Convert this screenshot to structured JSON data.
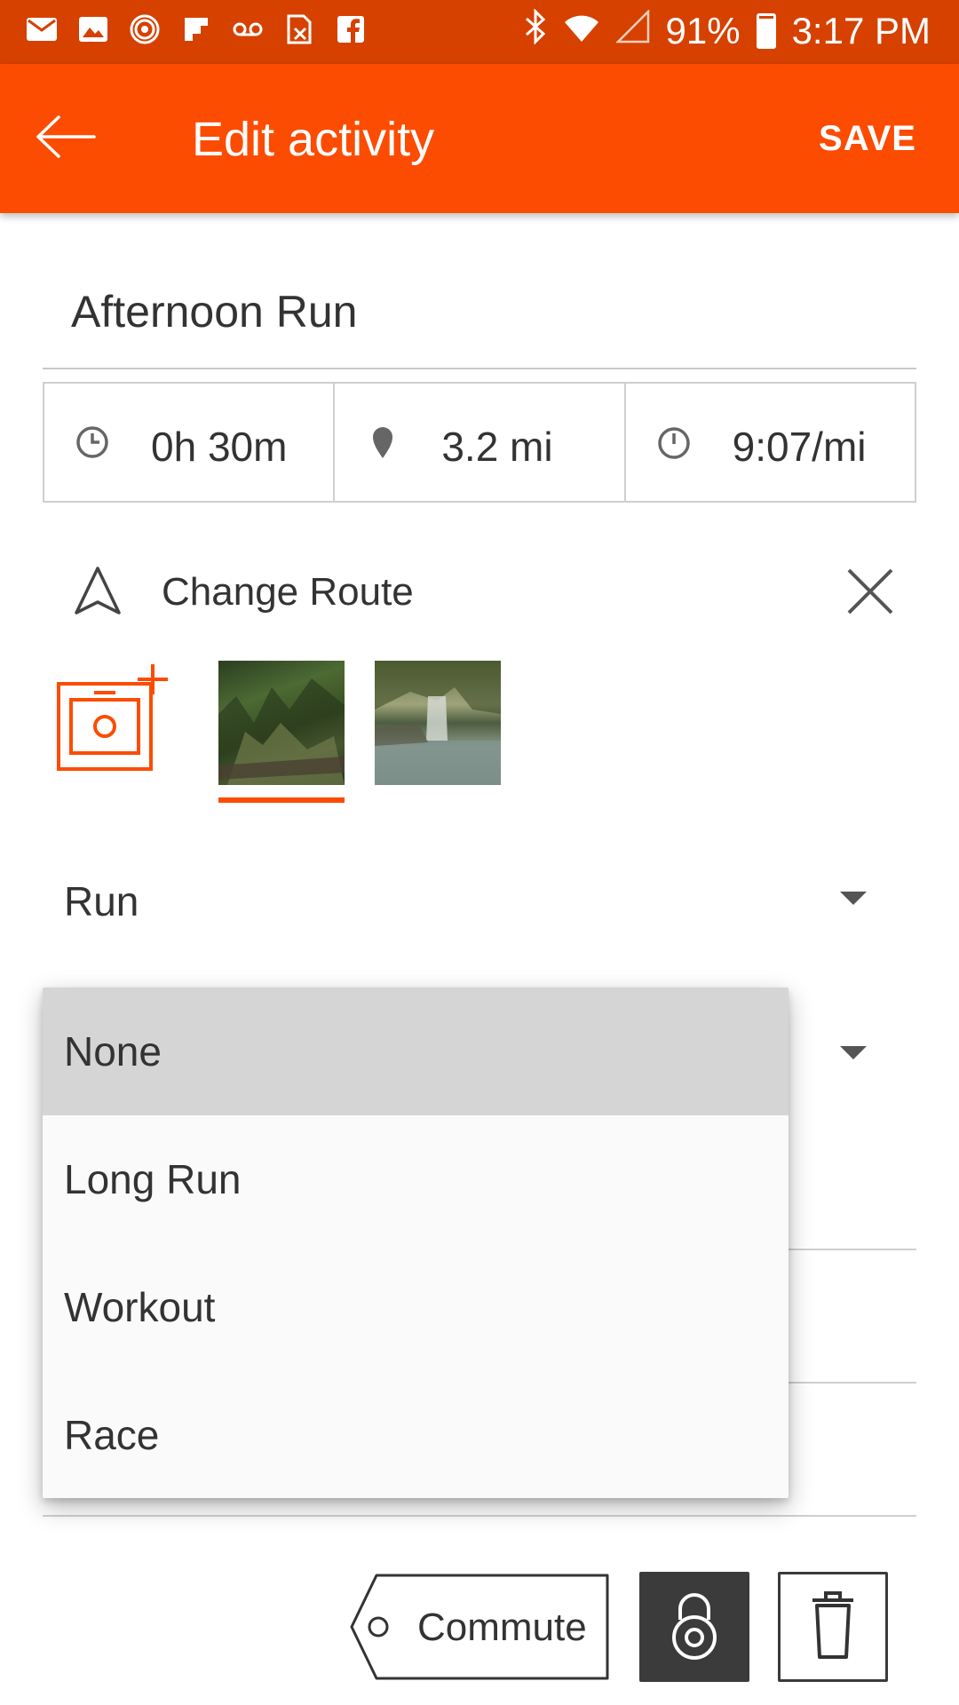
{
  "status_bar": {
    "battery": "91%",
    "battery_level": 0.91,
    "time": "3:17 PM",
    "icons": [
      "mail-icon",
      "image-icon",
      "hotspot-icon",
      "flipboard-icon",
      "voicemail-icon",
      "sim-icon",
      "facebook-icon",
      "bluetooth-icon",
      "wifi-icon",
      "signal-icon",
      "battery-icon"
    ]
  },
  "app_bar": {
    "title": "Edit activity",
    "save_label": "SAVE",
    "back_icon": "arrow-back-icon"
  },
  "activity": {
    "name": "Afternoon Run",
    "stats": [
      {
        "icon": "clock-icon",
        "value": "0h 30m"
      },
      {
        "icon": "location-pin-icon",
        "value": "3.2 mi"
      },
      {
        "icon": "pace-icon",
        "value": "9:07/mi"
      }
    ],
    "route_label": "Change Route",
    "sport_type": "Run"
  },
  "dropdown": {
    "options": [
      "None",
      "Long Run",
      "Workout",
      "Race"
    ],
    "selected": "None"
  },
  "bottom": {
    "commute_label": "Commute"
  },
  "colors": {
    "status_bar": "#d64100",
    "brand": "#fc4c02",
    "text": "#333333",
    "dark_button": "#3b3b3b"
  }
}
